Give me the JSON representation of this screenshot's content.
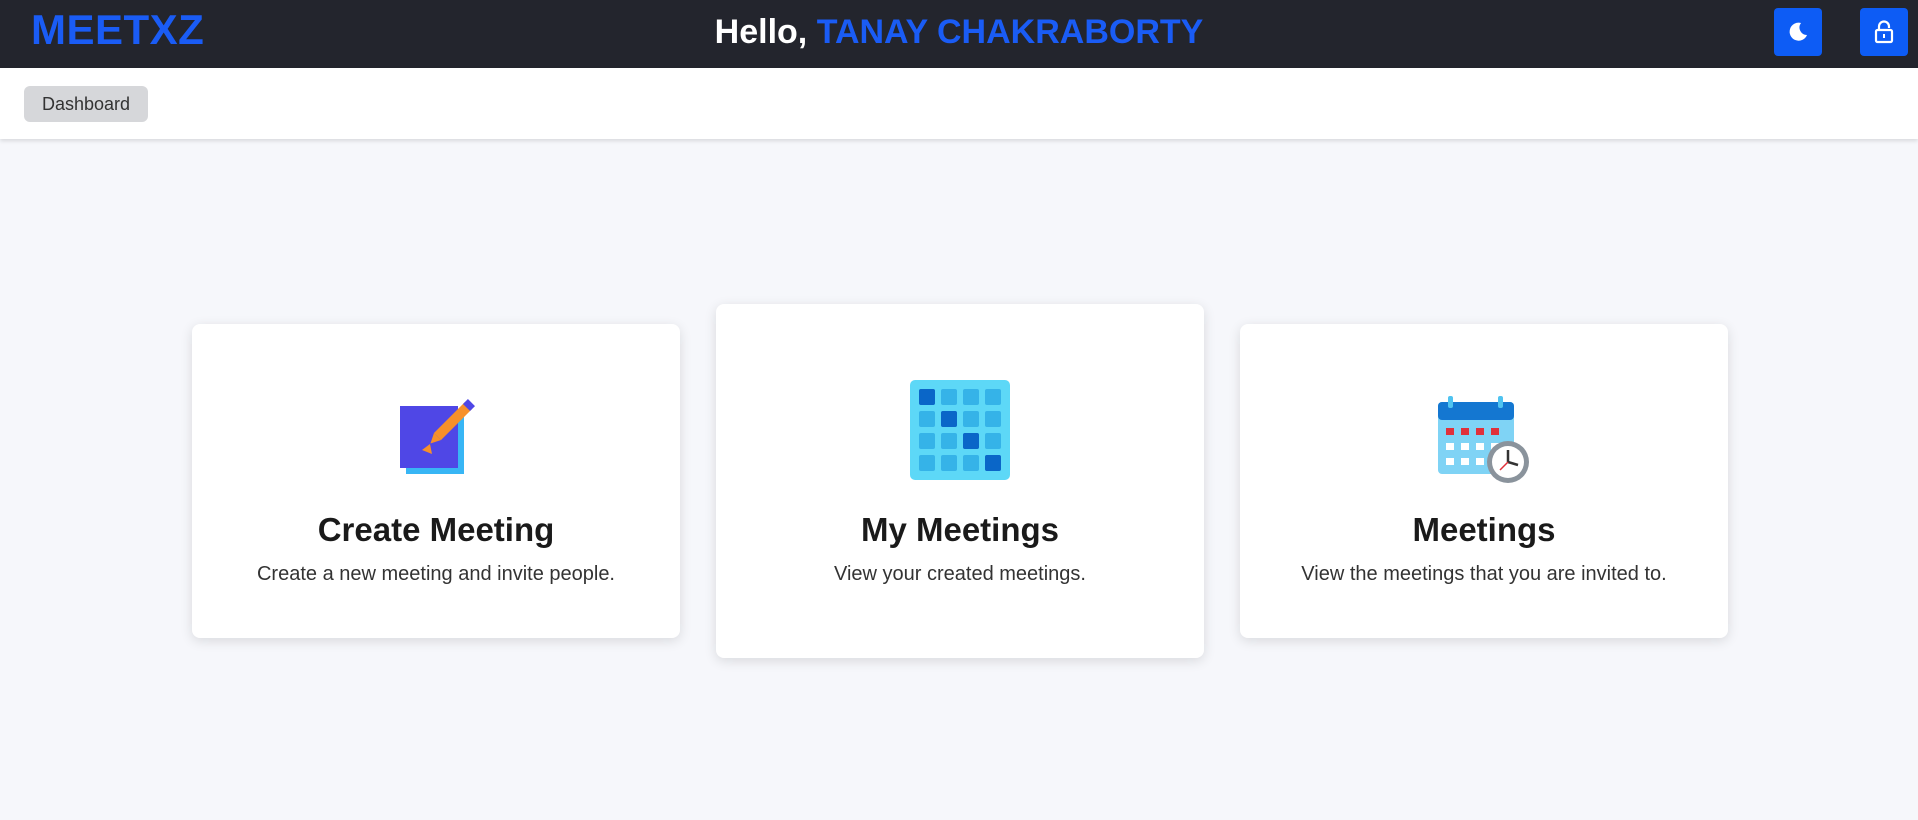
{
  "header": {
    "logo": "MEETXZ",
    "greeting_prefix": "Hello, ",
    "user_name": "TANAY CHAKRABORTY",
    "theme_toggle_icon": "moon-icon",
    "lock_icon": "lock-icon"
  },
  "breadcrumb": {
    "label": "Dashboard"
  },
  "cards": [
    {
      "title": "Create Meeting",
      "description": "Create a new meeting and invite people.",
      "icon": "edit-note-icon"
    },
    {
      "title": "My Meetings",
      "description": "View your created meetings.",
      "icon": "calendar-grid-icon"
    },
    {
      "title": "Meetings",
      "description": "View the meetings that you are invited to.",
      "icon": "calendar-clock-icon"
    }
  ],
  "colors": {
    "brand": "#1a5cf5",
    "topbar_bg": "#23252d",
    "button_bg": "#0d5cf5",
    "page_bg": "#f6f7fb"
  }
}
